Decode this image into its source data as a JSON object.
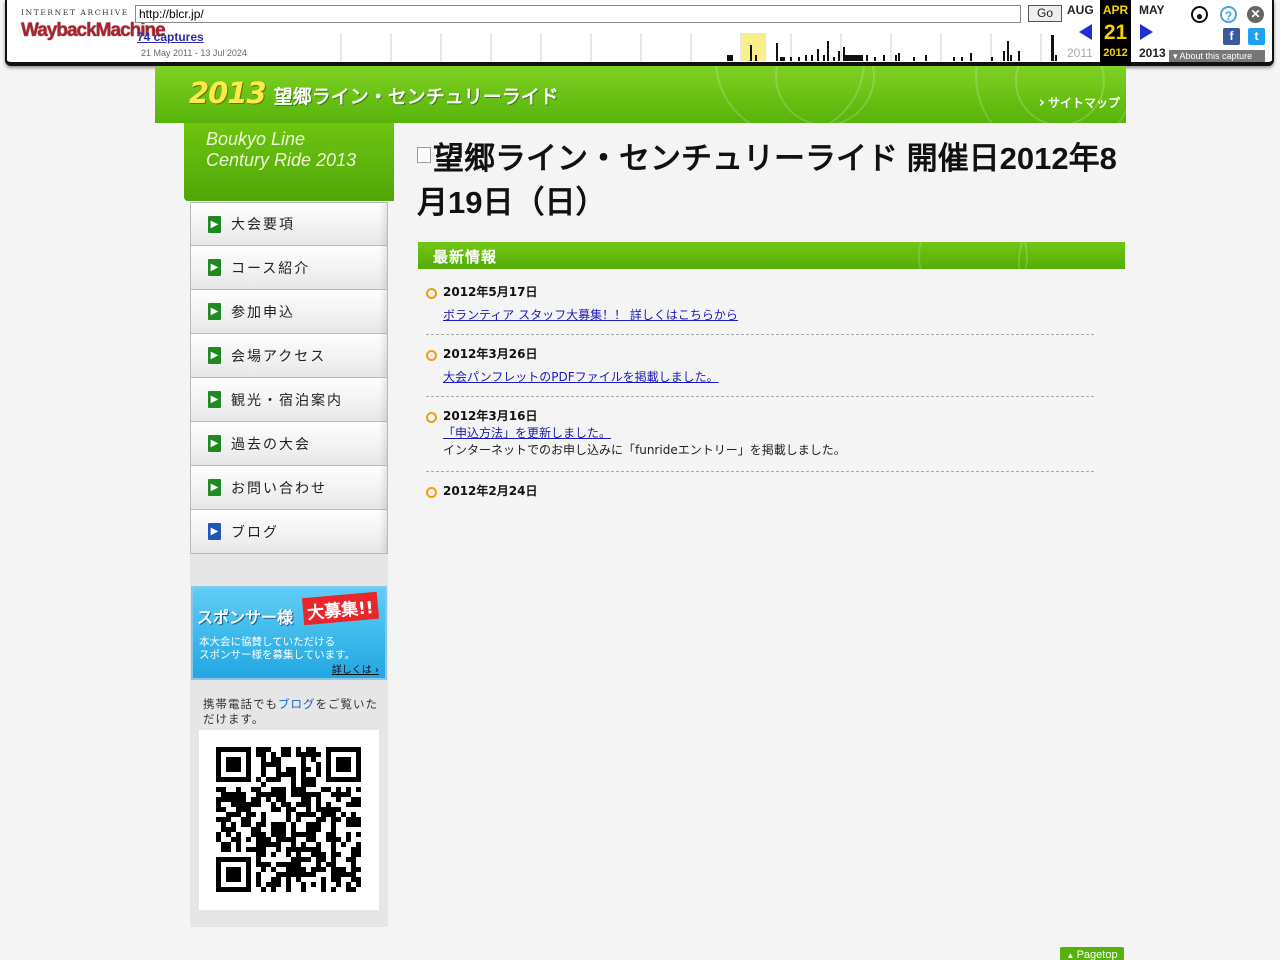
{
  "wayback": {
    "logo_top": "INTERNET ARCHIVE",
    "logo_main": "WaybackMachine",
    "url": "http://blcr.jp/",
    "go_label": "Go",
    "captures": "74 captures",
    "range": "21 May 2011 - 13 Jul 2024",
    "month_prev": "AUG",
    "month_cur": "APR",
    "month_next": "MAY",
    "day": "21",
    "year_prev": "2011",
    "year_cur": "2012",
    "year_next": "2013",
    "about": "About this capture"
  },
  "header": {
    "year": "2013",
    "title": "望郷ライン・センチュリーライド",
    "sitemap": "サイトマップ"
  },
  "brand": {
    "line1": "Boukyo Line",
    "line2": "Century Ride 2013"
  },
  "nav": {
    "items": [
      {
        "label": "大会要項"
      },
      {
        "label": "コース紹介"
      },
      {
        "label": "参加申込"
      },
      {
        "label": "会場アクセス"
      },
      {
        "label": "観光・宿泊案内"
      },
      {
        "label": "過去の大会"
      },
      {
        "label": "お問い合わせ"
      },
      {
        "label": "ブログ"
      }
    ]
  },
  "sponsor": {
    "title": "スポンサー様",
    "badge": "大募集!!",
    "body1": "本大会に協賛していただける",
    "body2": "スポンサー様を募集しています。",
    "more": "詳しくは"
  },
  "mobile": {
    "text1": "携帯電話でも",
    "link": "ブログ",
    "text2": "をご覧いただけます。"
  },
  "main": {
    "heading": "望郷ライン・センチュリーライド 開催日2012年8月19日（日）",
    "news_title": "最新情報",
    "news": [
      {
        "date": "2012年5月17日",
        "link": "ボランティア スタッフ大募集！！ 詳しくはこちらから",
        "desc": ""
      },
      {
        "date": "2012年3月26日",
        "link": "大会パンフレットのPDFファイルを掲載しました。",
        "desc": ""
      },
      {
        "date": "2012年3月16日",
        "link": "「申込方法」を更新しました。",
        "desc": "インターネットでのお申し込みに「funrideエントリー」を掲載しました。"
      },
      {
        "date": "2012年2月24日",
        "link": "",
        "desc": ""
      }
    ]
  },
  "footer": {
    "pagetop": "Pagetop"
  }
}
